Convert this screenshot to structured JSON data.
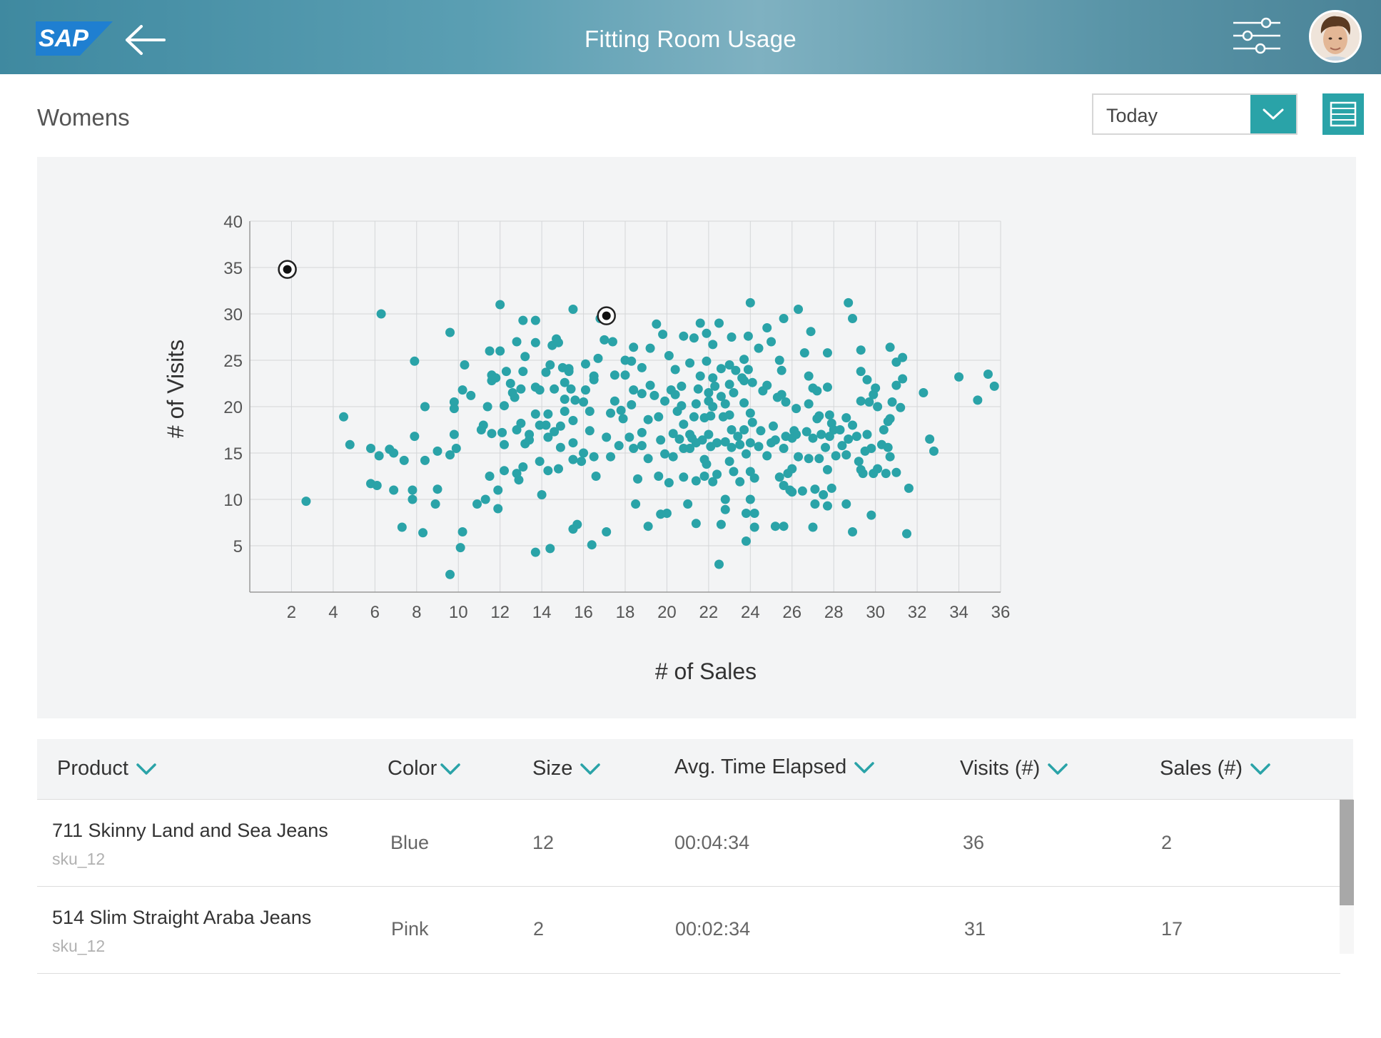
{
  "header": {
    "logo_text": "SAP",
    "title": "Fitting Room Usage",
    "back_icon": "back-arrow-icon",
    "filter_icon": "sliders-icon",
    "avatar_icon": "user-avatar"
  },
  "section": {
    "title": "Womens"
  },
  "period_select": {
    "selected": "Today",
    "icon": "chevron-down-icon"
  },
  "view_toggle": {
    "icon": "list-view-icon"
  },
  "colors": {
    "accent": "#2aa3a8",
    "header": "#4e93a7",
    "panel": "#f3f4f5"
  },
  "chart_data": {
    "type": "scatter",
    "xlabel": "# of Sales",
    "ylabel": "# of Visits",
    "xlim": [
      0,
      36
    ],
    "ylim": [
      0,
      40
    ],
    "xticks": [
      2,
      4,
      6,
      8,
      10,
      12,
      14,
      16,
      18,
      20,
      22,
      24,
      26,
      28,
      30,
      32,
      34,
      36
    ],
    "yticks": [
      5,
      10,
      15,
      20,
      25,
      30,
      35,
      40
    ],
    "grid": true,
    "highlighted_points": [
      [
        1.8,
        34.8
      ],
      [
        17.1,
        29.8
      ]
    ],
    "points": [
      [
        2.7,
        9.8
      ],
      [
        4.5,
        18.9
      ],
      [
        4.8,
        15.9
      ],
      [
        5.8,
        15.5
      ],
      [
        5.8,
        11.7
      ],
      [
        6.1,
        11.5
      ],
      [
        6.2,
        14.7
      ],
      [
        6.3,
        30.0
      ],
      [
        6.7,
        15.4
      ],
      [
        6.9,
        11.0
      ],
      [
        6.9,
        15.0
      ],
      [
        7.3,
        7.0
      ],
      [
        7.4,
        14.2
      ],
      [
        7.8,
        11.0
      ],
      [
        7.8,
        10.0
      ],
      [
        7.9,
        16.8
      ],
      [
        7.9,
        24.9
      ],
      [
        8.3,
        6.4
      ],
      [
        8.4,
        14.2
      ],
      [
        8.4,
        20.0
      ],
      [
        8.9,
        9.5
      ],
      [
        9.0,
        11.1
      ],
      [
        9.0,
        15.2
      ],
      [
        9.6,
        14.8
      ],
      [
        9.6,
        1.9
      ],
      [
        9.6,
        28.0
      ],
      [
        9.8,
        20.5
      ],
      [
        9.9,
        15.5
      ],
      [
        9.8,
        17.0
      ],
      [
        9.8,
        19.8
      ],
      [
        10.1,
        4.8
      ],
      [
        10.2,
        6.5
      ],
      [
        10.2,
        21.8
      ],
      [
        10.3,
        24.5
      ],
      [
        10.6,
        21.2
      ],
      [
        10.9,
        9.5
      ],
      [
        11.1,
        17.5
      ],
      [
        11.2,
        18.0
      ],
      [
        11.3,
        10.0
      ],
      [
        11.5,
        26.0
      ],
      [
        11.4,
        20.0
      ],
      [
        11.6,
        22.8
      ],
      [
        11.6,
        23.4
      ],
      [
        11.6,
        17.1
      ],
      [
        11.5,
        12.5
      ],
      [
        11.8,
        23.1
      ],
      [
        11.9,
        9.0
      ],
      [
        11.9,
        11.0
      ],
      [
        12.0,
        31.0
      ],
      [
        12.0,
        26.0
      ],
      [
        12.1,
        17.2
      ],
      [
        12.2,
        20.1
      ],
      [
        12.2,
        15.9
      ],
      [
        12.3,
        23.8
      ],
      [
        12.2,
        13.1
      ],
      [
        12.5,
        22.5
      ],
      [
        12.6,
        21.5
      ],
      [
        12.7,
        21.0
      ],
      [
        12.8,
        17.5
      ],
      [
        12.8,
        27.0
      ],
      [
        12.9,
        12.1
      ],
      [
        12.8,
        12.8
      ],
      [
        13.1,
        29.3
      ],
      [
        13.0,
        21.9
      ],
      [
        13.0,
        18.2
      ],
      [
        13.1,
        13.5
      ],
      [
        13.2,
        16.0
      ],
      [
        13.1,
        23.8
      ],
      [
        13.2,
        25.4
      ],
      [
        13.4,
        16.4
      ],
      [
        13.4,
        17.0
      ],
      [
        13.7,
        4.3
      ],
      [
        13.7,
        26.9
      ],
      [
        13.7,
        29.3
      ],
      [
        13.7,
        19.2
      ],
      [
        13.7,
        22.1
      ],
      [
        13.9,
        21.8
      ],
      [
        13.9,
        14.1
      ],
      [
        13.9,
        18.0
      ],
      [
        14.0,
        10.5
      ],
      [
        14.2,
        18.0
      ],
      [
        14.3,
        16.7
      ],
      [
        14.3,
        19.2
      ],
      [
        14.2,
        23.7
      ],
      [
        14.3,
        13.1
      ],
      [
        14.4,
        24.5
      ],
      [
        14.4,
        4.7
      ],
      [
        14.5,
        26.6
      ],
      [
        14.7,
        27.3
      ],
      [
        14.6,
        17.3
      ],
      [
        14.6,
        21.9
      ],
      [
        14.8,
        26.9
      ],
      [
        14.8,
        13.3
      ],
      [
        15.1,
        22.6
      ],
      [
        15.0,
        24.2
      ],
      [
        14.9,
        17.9
      ],
      [
        14.9,
        15.6
      ],
      [
        15.1,
        20.8
      ],
      [
        15.1,
        19.5
      ],
      [
        15.3,
        24.1
      ],
      [
        15.3,
        23.8
      ],
      [
        15.4,
        21.9
      ],
      [
        15.5,
        6.8
      ],
      [
        15.5,
        14.3
      ],
      [
        15.5,
        30.5
      ],
      [
        15.5,
        16.1
      ],
      [
        15.6,
        20.7
      ],
      [
        15.5,
        18.5
      ],
      [
        15.7,
        7.3
      ],
      [
        15.9,
        14.1
      ],
      [
        16.0,
        15.0
      ],
      [
        16.0,
        20.5
      ],
      [
        16.1,
        24.6
      ],
      [
        16.1,
        21.8
      ],
      [
        16.3,
        17.4
      ],
      [
        16.3,
        19.5
      ],
      [
        16.4,
        5.1
      ],
      [
        16.5,
        14.6
      ],
      [
        16.5,
        23.3
      ],
      [
        16.8,
        29.5
      ],
      [
        16.6,
        12.5
      ],
      [
        16.5,
        22.9
      ],
      [
        17.0,
        27.2
      ],
      [
        16.7,
        25.2
      ],
      [
        17.2,
        29.4
      ],
      [
        17.1,
        16.7
      ],
      [
        17.3,
        19.3
      ],
      [
        17.3,
        14.6
      ],
      [
        17.5,
        20.6
      ],
      [
        17.4,
        27.0
      ],
      [
        17.1,
        6.5
      ],
      [
        17.7,
        15.8
      ],
      [
        17.8,
        19.6
      ],
      [
        17.5,
        23.4
      ],
      [
        17.9,
        18.7
      ],
      [
        18.0,
        25.0
      ],
      [
        18.2,
        16.7
      ],
      [
        18.0,
        23.4
      ],
      [
        18.3,
        20.2
      ],
      [
        18.4,
        15.5
      ],
      [
        18.3,
        24.9
      ],
      [
        18.5,
        9.5
      ],
      [
        18.4,
        26.4
      ],
      [
        18.4,
        21.8
      ],
      [
        18.6,
        12.2
      ],
      [
        18.8,
        21.4
      ],
      [
        18.8,
        24.2
      ],
      [
        18.8,
        15.8
      ],
      [
        18.8,
        17.2
      ],
      [
        19.1,
        14.4
      ],
      [
        19.1,
        18.6
      ],
      [
        19.2,
        26.3
      ],
      [
        19.2,
        22.3
      ],
      [
        19.1,
        7.1
      ],
      [
        19.4,
        21.2
      ],
      [
        19.5,
        28.9
      ],
      [
        19.6,
        18.9
      ],
      [
        19.7,
        16.4
      ],
      [
        19.6,
        12.5
      ],
      [
        19.7,
        8.4
      ],
      [
        19.8,
        27.8
      ],
      [
        19.9,
        14.9
      ],
      [
        19.9,
        20.6
      ],
      [
        20.0,
        8.5
      ],
      [
        20.1,
        25.5
      ],
      [
        20.2,
        21.8
      ],
      [
        20.1,
        11.8
      ],
      [
        20.3,
        14.6
      ],
      [
        20.3,
        17.1
      ],
      [
        20.4,
        21.3
      ],
      [
        20.4,
        24.0
      ],
      [
        20.5,
        19.5
      ],
      [
        20.6,
        16.5
      ],
      [
        20.7,
        22.2
      ],
      [
        20.8,
        15.5
      ],
      [
        20.8,
        27.6
      ],
      [
        20.8,
        12.4
      ],
      [
        20.8,
        18.1
      ],
      [
        20.7,
        20.1
      ],
      [
        21.0,
        9.5
      ],
      [
        21.1,
        17.0
      ],
      [
        21.1,
        15.5
      ],
      [
        21.1,
        24.7
      ],
      [
        21.2,
        16.6
      ],
      [
        21.3,
        18.9
      ],
      [
        21.4,
        7.4
      ],
      [
        21.3,
        27.4
      ],
      [
        21.4,
        12.0
      ],
      [
        21.4,
        20.3
      ],
      [
        21.4,
        16.1
      ],
      [
        21.5,
        21.9
      ],
      [
        21.6,
        29.0
      ],
      [
        21.6,
        23.3
      ],
      [
        21.7,
        16.4
      ],
      [
        21.8,
        12.5
      ],
      [
        21.8,
        18.8
      ],
      [
        21.8,
        14.3
      ],
      [
        21.9,
        13.8
      ],
      [
        21.9,
        27.9
      ],
      [
        22.0,
        21.5
      ],
      [
        21.9,
        24.9
      ],
      [
        22.0,
        20.6
      ],
      [
        22.0,
        17.0
      ],
      [
        22.1,
        19.0
      ],
      [
        22.1,
        15.7
      ],
      [
        22.2,
        26.7
      ],
      [
        22.2,
        20.0
      ],
      [
        22.2,
        23.1
      ],
      [
        22.2,
        11.9
      ],
      [
        22.3,
        22.2
      ],
      [
        22.4,
        12.7
      ],
      [
        22.4,
        16.1
      ],
      [
        22.5,
        29.0
      ],
      [
        22.6,
        24.1
      ],
      [
        22.6,
        21.1
      ],
      [
        22.7,
        18.9
      ],
      [
        22.6,
        7.3
      ],
      [
        22.5,
        3.0
      ],
      [
        22.8,
        16.2
      ],
      [
        22.8,
        20.3
      ],
      [
        22.8,
        10.0
      ],
      [
        22.8,
        8.9
      ],
      [
        23.0,
        24.5
      ],
      [
        23.0,
        22.4
      ],
      [
        23.0,
        19.1
      ],
      [
        23.0,
        14.1
      ],
      [
        23.1,
        17.5
      ],
      [
        23.1,
        15.6
      ],
      [
        23.1,
        27.5
      ],
      [
        23.2,
        13.0
      ],
      [
        23.2,
        21.5
      ],
      [
        23.3,
        23.9
      ],
      [
        23.4,
        16.8
      ],
      [
        23.5,
        11.9
      ],
      [
        23.5,
        15.9
      ],
      [
        23.6,
        23.1
      ],
      [
        23.7,
        22.8
      ],
      [
        23.7,
        25.1
      ],
      [
        23.7,
        17.5
      ],
      [
        23.7,
        20.4
      ],
      [
        23.8,
        8.5
      ],
      [
        23.8,
        14.9
      ],
      [
        23.8,
        5.5
      ],
      [
        23.9,
        27.6
      ],
      [
        23.9,
        24.0
      ],
      [
        24.0,
        16.1
      ],
      [
        24.0,
        19.3
      ],
      [
        24.0,
        31.2
      ],
      [
        24.0,
        10.0
      ],
      [
        24.0,
        13.0
      ],
      [
        24.1,
        18.3
      ],
      [
        24.1,
        22.6
      ],
      [
        24.2,
        7.0
      ],
      [
        24.2,
        8.5
      ],
      [
        24.2,
        12.3
      ],
      [
        24.4,
        15.7
      ],
      [
        24.4,
        26.3
      ],
      [
        24.5,
        17.4
      ],
      [
        24.6,
        21.7
      ],
      [
        24.8,
        14.7
      ],
      [
        24.8,
        28.5
      ],
      [
        24.8,
        22.3
      ],
      [
        25.0,
        16.1
      ],
      [
        25.0,
        27.0
      ],
      [
        25.1,
        17.9
      ],
      [
        25.2,
        16.4
      ],
      [
        25.2,
        7.1
      ],
      [
        25.3,
        21.0
      ],
      [
        25.4,
        12.4
      ],
      [
        25.4,
        25.0
      ],
      [
        25.5,
        23.9
      ],
      [
        25.5,
        21.3
      ],
      [
        25.6,
        29.5
      ],
      [
        25.6,
        7.1
      ],
      [
        25.6,
        11.5
      ],
      [
        25.6,
        15.5
      ],
      [
        25.7,
        16.8
      ],
      [
        25.7,
        20.5
      ],
      [
        25.8,
        12.8
      ],
      [
        25.9,
        11.0
      ],
      [
        26.0,
        13.3
      ],
      [
        26.0,
        16.6
      ],
      [
        26.0,
        10.8
      ],
      [
        26.1,
        17.4
      ],
      [
        26.2,
        19.8
      ],
      [
        26.3,
        14.6
      ],
      [
        26.2,
        17.0
      ],
      [
        26.3,
        30.5
      ],
      [
        26.5,
        10.9
      ],
      [
        26.6,
        25.8
      ],
      [
        26.7,
        17.3
      ],
      [
        26.8,
        14.4
      ],
      [
        26.8,
        20.3
      ],
      [
        26.8,
        23.3
      ],
      [
        26.9,
        28.1
      ],
      [
        27.0,
        22.0
      ],
      [
        27.0,
        7.0
      ],
      [
        27.0,
        16.6
      ],
      [
        27.1,
        9.5
      ],
      [
        27.1,
        11.1
      ],
      [
        27.2,
        18.7
      ],
      [
        27.2,
        21.7
      ],
      [
        27.3,
        19.0
      ],
      [
        27.3,
        14.4
      ],
      [
        27.4,
        17.0
      ],
      [
        27.5,
        10.5
      ],
      [
        27.6,
        15.6
      ],
      [
        27.7,
        25.8
      ],
      [
        27.7,
        22.1
      ],
      [
        27.7,
        13.2
      ],
      [
        27.7,
        9.3
      ],
      [
        27.8,
        16.8
      ],
      [
        27.9,
        11.2
      ],
      [
        27.8,
        19.1
      ],
      [
        27.9,
        18.2
      ],
      [
        28.0,
        17.5
      ],
      [
        28.1,
        14.7
      ],
      [
        28.3,
        17.5
      ],
      [
        28.4,
        15.8
      ],
      [
        28.6,
        9.5
      ],
      [
        28.6,
        14.8
      ],
      [
        28.6,
        18.8
      ],
      [
        28.7,
        16.5
      ],
      [
        28.7,
        31.2
      ],
      [
        28.9,
        29.5
      ],
      [
        28.9,
        6.5
      ],
      [
        28.9,
        18.0
      ],
      [
        29.1,
        16.8
      ],
      [
        29.2,
        14.1
      ],
      [
        29.3,
        23.8
      ],
      [
        29.3,
        20.6
      ],
      [
        29.3,
        26.1
      ],
      [
        29.3,
        13.2
      ],
      [
        29.4,
        12.8
      ],
      [
        29.5,
        15.2
      ],
      [
        29.6,
        17.0
      ],
      [
        29.6,
        22.9
      ],
      [
        29.7,
        20.5
      ],
      [
        29.8,
        15.5
      ],
      [
        29.8,
        8.3
      ],
      [
        29.9,
        12.8
      ],
      [
        29.9,
        21.3
      ],
      [
        30.0,
        22.0
      ],
      [
        30.1,
        13.3
      ],
      [
        30.1,
        20.0
      ],
      [
        30.3,
        15.9
      ],
      [
        30.4,
        17.5
      ],
      [
        30.5,
        12.8
      ],
      [
        30.6,
        15.6
      ],
      [
        30.6,
        18.4
      ],
      [
        30.7,
        26.4
      ],
      [
        30.7,
        14.6
      ],
      [
        30.7,
        18.7
      ],
      [
        30.8,
        20.5
      ],
      [
        31.0,
        22.3
      ],
      [
        31.0,
        24.8
      ],
      [
        31.0,
        12.9
      ],
      [
        31.2,
        19.9
      ],
      [
        31.3,
        23.0
      ],
      [
        31.3,
        25.3
      ],
      [
        31.5,
        6.3
      ],
      [
        31.6,
        11.2
      ],
      [
        32.3,
        21.5
      ],
      [
        32.6,
        16.5
      ],
      [
        32.8,
        15.2
      ],
      [
        34.0,
        23.2
      ],
      [
        34.9,
        20.7
      ],
      [
        35.4,
        23.5
      ],
      [
        35.7,
        22.2
      ]
    ]
  },
  "table": {
    "columns": [
      "Product",
      "Color",
      "Size",
      "Avg. Time Elapsed",
      "Visits (#)",
      "Sales (#)"
    ],
    "rows": [
      {
        "product": "711 Skinny Land and Sea Jeans",
        "sku": "sku_12",
        "color": "Blue",
        "size": "12",
        "avg_time": "00:04:34",
        "visits": "36",
        "sales": "2"
      },
      {
        "product": "514 Slim Straight Araba Jeans",
        "sku": "sku_12",
        "color": "Pink",
        "size": "2",
        "avg_time": "00:02:34",
        "visits": "31",
        "sales": "17"
      }
    ]
  }
}
